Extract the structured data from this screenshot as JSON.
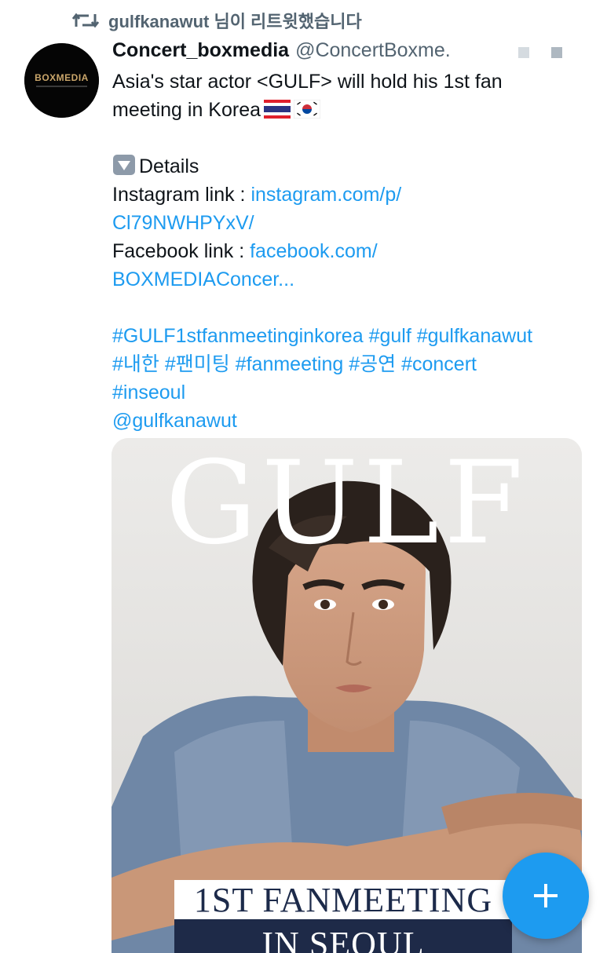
{
  "retweet": {
    "icon": "retweet-icon",
    "text": "gulfkanawut 님이 리트윗했습니다"
  },
  "tweet": {
    "avatar": {
      "label": "BOXMEDIA"
    },
    "display_name": "Concert_boxmedia",
    "handle": "@ConcertBoxme.",
    "text_line1": "Asia's star actor <GULF> will hold his 1st fan",
    "text_line2": "meeting in Korea",
    "flags": [
      "thailand-flag",
      "south-korea-flag"
    ],
    "details_label": "Details",
    "instagram_prefix": "Instagram link : ",
    "instagram_link_part1": "instagram.com/p/",
    "instagram_link_part2": "Cl79NWHPYxV/",
    "facebook_prefix": "Facebook link : ",
    "facebook_link_part1": "facebook.com/",
    "facebook_link_part2": "BOXMEDIAConcer...",
    "hashtags_line1": "#GULF1stfanmeetinginkorea #gulf #gulfkanawut",
    "hashtags_line2": "#내한 #팬미팅 #fanmeeting #공연 #concert",
    "hashtags_line3": "#inseoul",
    "mention": "@gulfkanawut"
  },
  "media": {
    "poster_title": "GULF",
    "banner_line1": "1ST FANMEETING",
    "banner_line2": "IN SEOUL"
  },
  "fab": {
    "icon": "plus-icon"
  },
  "colors": {
    "link": "#1d9bf0",
    "secondary_text": "#536471",
    "primary_text": "#0f1419",
    "banner_navy": "#1e2a48"
  }
}
